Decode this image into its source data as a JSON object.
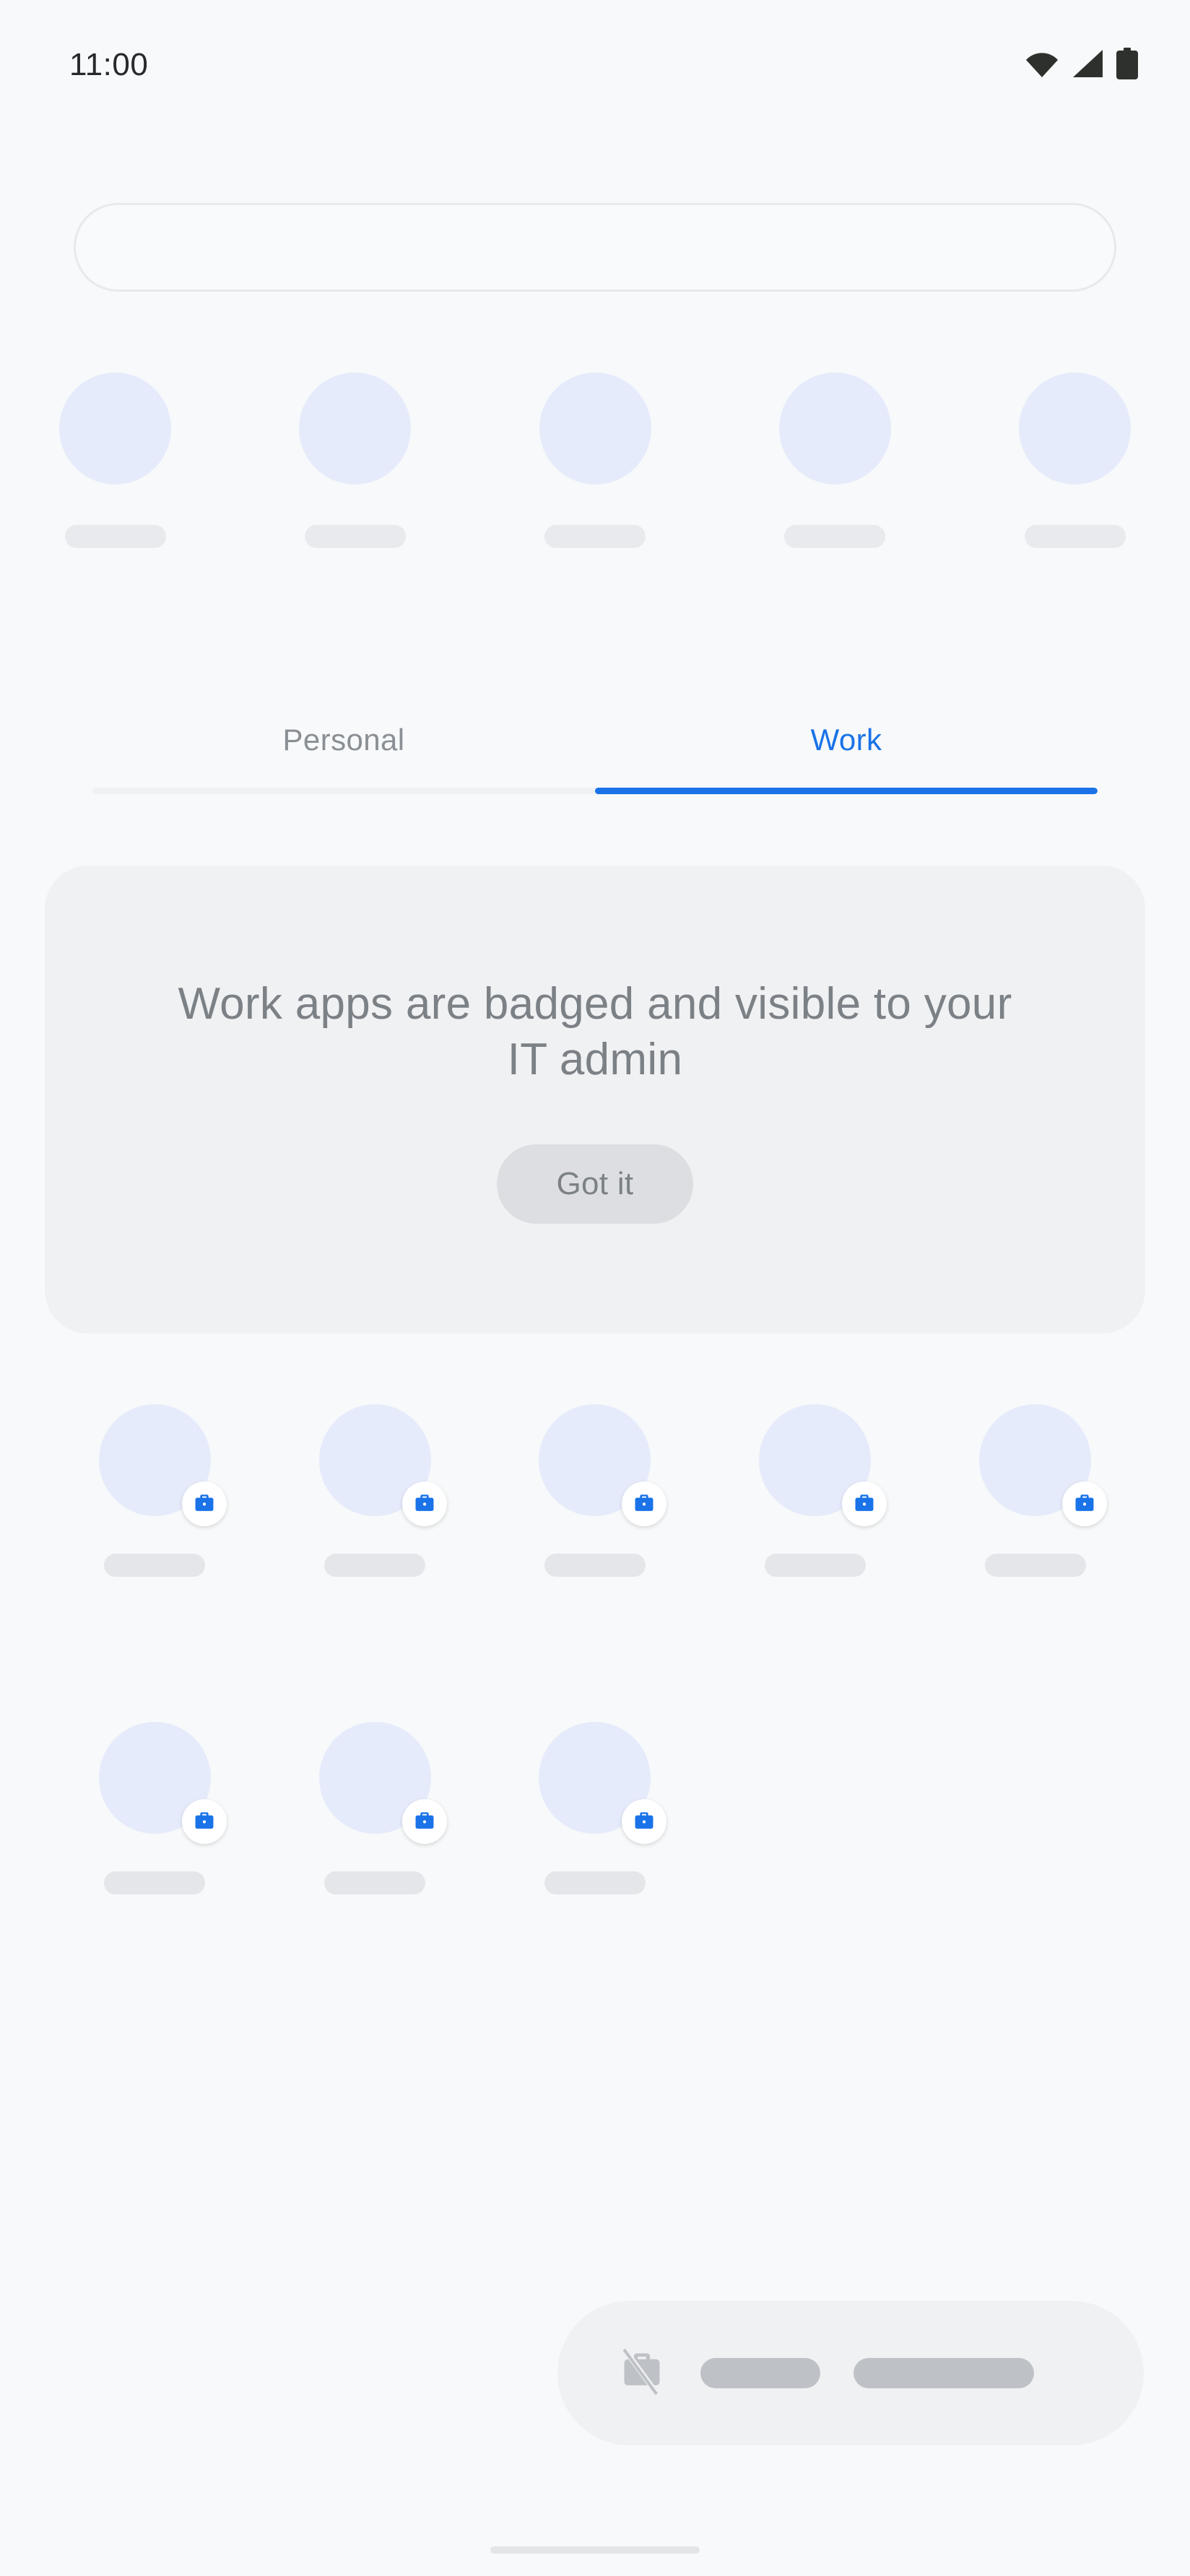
{
  "status_bar": {
    "clock": "11:00",
    "icons": [
      {
        "name": "wifi-icon",
        "label": "Wi-Fi"
      },
      {
        "name": "cellular-signal-icon",
        "label": "Cellular signal"
      },
      {
        "name": "battery-icon",
        "label": "Battery full"
      }
    ]
  },
  "search": {
    "value": "",
    "placeholder": ""
  },
  "recent_apps": {
    "count": 5,
    "items": [
      {
        "label": ""
      },
      {
        "label": ""
      },
      {
        "label": ""
      },
      {
        "label": ""
      },
      {
        "label": ""
      }
    ]
  },
  "tabs": {
    "items": [
      {
        "label": "Personal",
        "active": false
      },
      {
        "label": "Work",
        "active": true
      }
    ],
    "active_index": 1,
    "active_color": "#1A73E8",
    "inactive_color": "#8A8F94"
  },
  "info_card": {
    "title": "Work apps are badged and visible to your IT admin",
    "button_label": "Got it",
    "background": "#F0F1F3",
    "text_color": "#7C8186"
  },
  "work_apps": {
    "badge_icon": "briefcase-icon",
    "badge_color": "#1A73E8",
    "rows": [
      [
        {
          "label": ""
        },
        {
          "label": ""
        },
        {
          "label": ""
        },
        {
          "label": ""
        },
        {
          "label": ""
        }
      ],
      [
        {
          "label": ""
        },
        {
          "label": ""
        },
        {
          "label": ""
        }
      ]
    ]
  },
  "bottom_bar": {
    "icon": "work-apps-paused-icon",
    "pill_a": "",
    "pill_b": "",
    "background": "#F0F1F3"
  },
  "gesture_nav": {
    "label": ""
  },
  "theme": {
    "page_background": "#F7F9FA",
    "icon_placeholder": "#E6EBFB",
    "label_placeholder": "#E8EAED",
    "accent": "#1A73E8"
  }
}
